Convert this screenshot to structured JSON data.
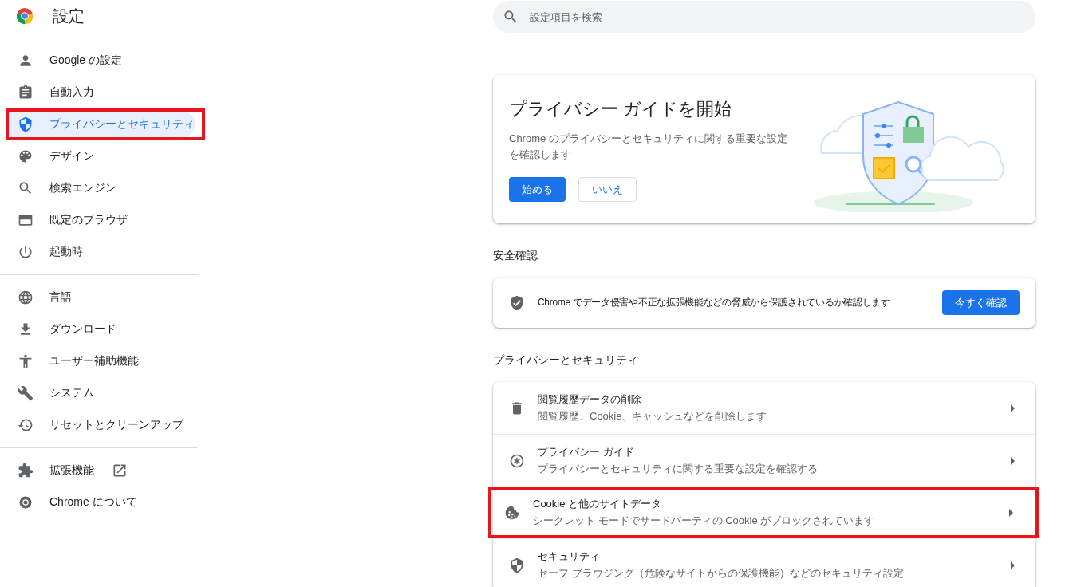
{
  "header": {
    "title": "設定"
  },
  "search": {
    "placeholder": "設定項目を検索"
  },
  "sidebar": {
    "groups": [
      [
        {
          "label": "Google の設定",
          "kind": "page",
          "selected": false,
          "highlighted": false
        },
        {
          "label": "自動入力",
          "kind": "page",
          "selected": false,
          "highlighted": false
        },
        {
          "label": "プライバシーとセキュリティ",
          "kind": "page",
          "selected": true,
          "highlighted": true
        },
        {
          "label": "デザイン",
          "kind": "page",
          "selected": false,
          "highlighted": false
        },
        {
          "label": "検索エンジン",
          "kind": "page",
          "selected": false,
          "highlighted": false
        },
        {
          "label": "既定のブラウザ",
          "kind": "page",
          "selected": false,
          "highlighted": false
        },
        {
          "label": "起動時",
          "kind": "page",
          "selected": false,
          "highlighted": false
        }
      ],
      [
        {
          "label": "言語",
          "kind": "page",
          "selected": false,
          "highlighted": false
        },
        {
          "label": "ダウンロード",
          "kind": "page",
          "selected": false,
          "highlighted": false
        },
        {
          "label": "ユーザー補助機能",
          "kind": "page",
          "selected": false,
          "highlighted": false
        },
        {
          "label": "システム",
          "kind": "page",
          "selected": false,
          "highlighted": false
        },
        {
          "label": "リセットとクリーンアップ",
          "kind": "page",
          "selected": false,
          "highlighted": false
        }
      ],
      [
        {
          "label": "拡張機能",
          "kind": "external",
          "selected": false,
          "highlighted": false
        },
        {
          "label": "Chrome について",
          "kind": "page",
          "selected": false,
          "highlighted": false
        }
      ]
    ]
  },
  "privacy_guide_card": {
    "title": "プライバシー ガイドを開始",
    "description": "Chrome のプライバシーとセキュリティに関する重要な設定を確認します",
    "primary_button": "始める",
    "secondary_button": "いいえ"
  },
  "safety_check": {
    "heading": "安全確認",
    "text": "Chrome でデータ侵害や不正な拡張機能などの脅威から保護されているか確認します",
    "button": "今すぐ確認"
  },
  "privacy_section": {
    "heading": "プライバシーとセキュリティ",
    "rows": [
      {
        "title": "閲覧履歴データの削除",
        "subtitle": "閲覧履歴、Cookie、キャッシュなどを削除します",
        "highlighted": false
      },
      {
        "title": "プライバシー ガイド",
        "subtitle": "プライバシーとセキュリティに関する重要な設定を確認する",
        "highlighted": false
      },
      {
        "title": "Cookie と他のサイトデータ",
        "subtitle": "シークレット モードでサードパーティの Cookie がブロックされています",
        "highlighted": true
      },
      {
        "title": "セキュリティ",
        "subtitle": "セーフ ブラウジング（危険なサイトからの保護機能）などのセキュリティ設定",
        "highlighted": false
      }
    ]
  }
}
